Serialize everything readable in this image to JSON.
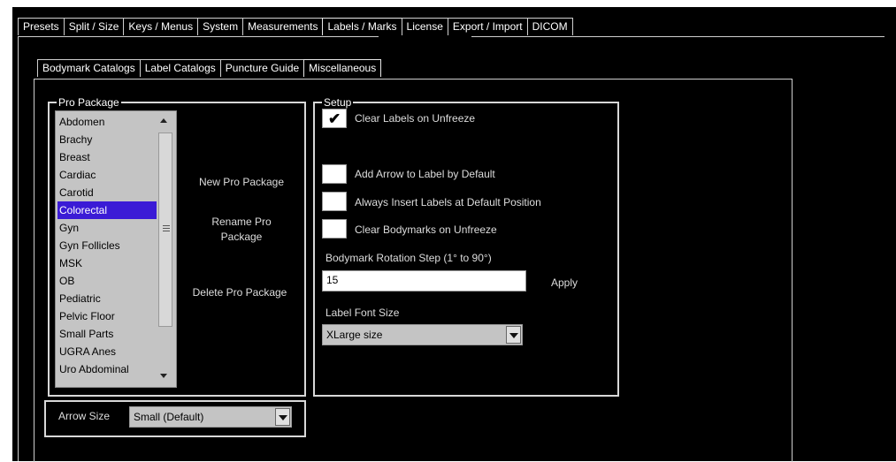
{
  "top_tabs": [
    "Presets",
    "Split / Size",
    "Keys / Menus",
    "System",
    "Measurements",
    "Labels / Marks",
    "License",
    "Export / Import",
    "DICOM"
  ],
  "active_top_tab": "Labels / Marks",
  "sub_tabs": [
    "Bodymark Catalogs",
    "Label Catalogs",
    "Puncture Guide",
    "Miscellaneous"
  ],
  "active_sub_tab": "Miscellaneous",
  "pro_package": {
    "legend": "Pro Package",
    "items": [
      "Abdomen",
      "Brachy",
      "Breast",
      "Cardiac",
      "Carotid",
      "Colorectal",
      "Gyn",
      "Gyn Follicles",
      "MSK",
      "OB",
      "Pediatric",
      "Pelvic Floor",
      "Small Parts",
      "UGRA Anes",
      "Uro Abdominal"
    ],
    "selected": "Colorectal",
    "new_label": "New Pro Package",
    "rename_label_1": "Rename Pro",
    "rename_label_2": "Package",
    "delete_label": "Delete Pro Package"
  },
  "setup": {
    "legend": "Setup",
    "checkboxes": [
      {
        "label": "Clear Labels on Unfreeze",
        "checked": true
      },
      {
        "label": "Add Arrow to Label by Default",
        "checked": false
      },
      {
        "label": "Always Insert Labels at Default Position",
        "checked": false
      },
      {
        "label": "Clear Bodymarks on Unfreeze",
        "checked": false
      }
    ],
    "rotation_label": "Bodymark Rotation Step (1° to 90°)",
    "rotation_value": "15",
    "apply_label": "Apply",
    "font_size_label": "Label Font Size",
    "font_size_value": "XLarge size"
  },
  "arrow_size": {
    "label": "Arrow Size",
    "value": "Small (Default)"
  }
}
